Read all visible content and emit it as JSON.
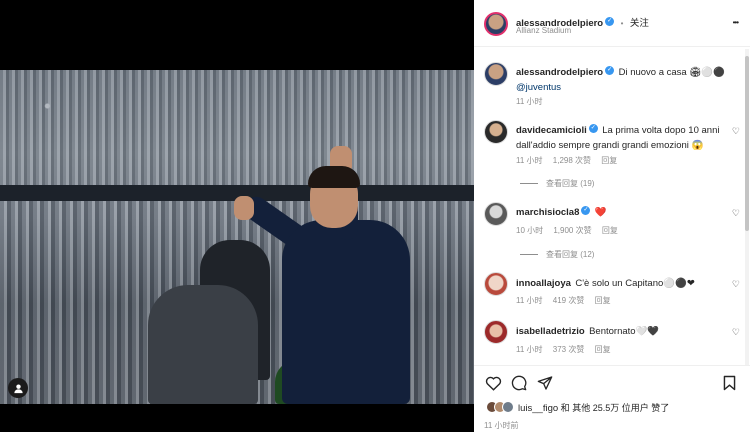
{
  "post": {
    "author": "alessandrodelpiero",
    "dot": "•",
    "follow_label": "关注",
    "location": "Allianz Stadium",
    "more": "•••",
    "caption": "Di nuovo a casa 🏟⚪⚫",
    "caption_mention": "@juventus",
    "caption_time": "11 小时"
  },
  "comments": [
    {
      "user": "davidecamicioli",
      "text": "La prima volta dopo 10 anni dall'addio sempre grandi grandi emozioni 😱",
      "time": "11 小时",
      "likes": "1,298 次赞",
      "reply": "回复",
      "view_replies": "查看回复 (19)"
    },
    {
      "user": "marchisiocla8",
      "text": "❤️",
      "time": "10 小时",
      "likes": "1,900 次赞",
      "reply": "回复",
      "view_replies": "查看回复 (12)"
    },
    {
      "user": "innoallajoya",
      "text": "C'è solo un Capitano⚪⚫❤",
      "time": "11 小时",
      "likes": "419 次赞",
      "reply": "回复"
    },
    {
      "user": "isabelladetrizio",
      "text": "Bentornato🤍🖤",
      "time": "11 小时",
      "likes": "373 次赞",
      "reply": "回复"
    }
  ],
  "likes_line": {
    "user": "luis__figo",
    "and": "和",
    "others": "其他 25.5万 位用户",
    "liked": "赞了"
  },
  "post_time": "11 小时前",
  "icons": {
    "like": "heart-icon",
    "comment": "comment-icon",
    "share": "send-icon",
    "save": "bookmark-icon",
    "tag": "user-tag-icon"
  },
  "colors": {
    "verified": "#3897f0",
    "heart_red": "#ed4956",
    "link": "#00376b"
  }
}
